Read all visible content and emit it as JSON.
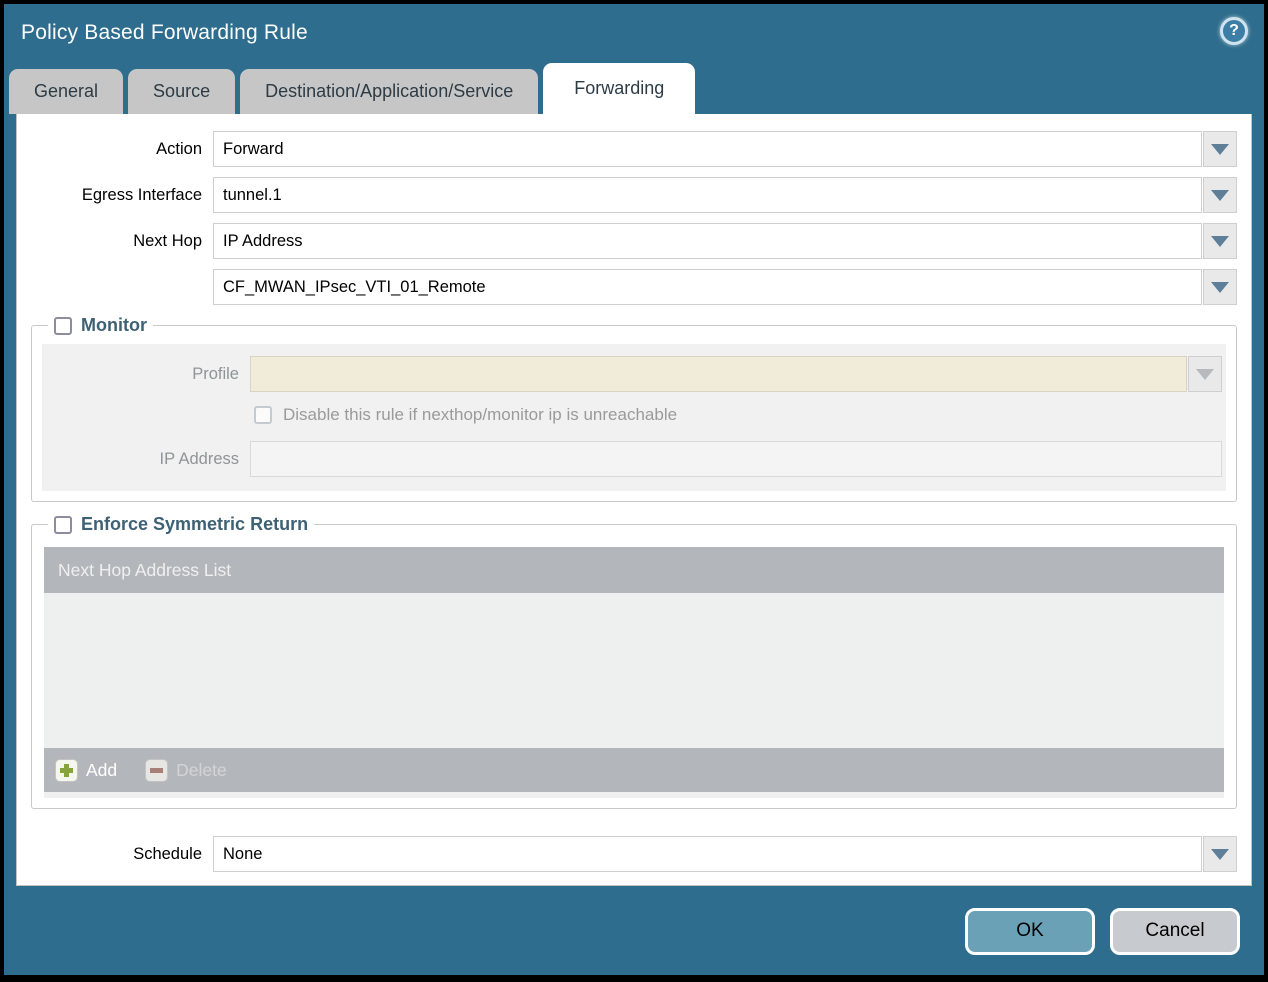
{
  "dialog": {
    "title": "Policy Based Forwarding Rule",
    "help_glyph": "?"
  },
  "tabs": [
    {
      "label": "General",
      "active": false
    },
    {
      "label": "Source",
      "active": false
    },
    {
      "label": "Destination/Application/Service",
      "active": false
    },
    {
      "label": "Forwarding",
      "active": true
    }
  ],
  "form": {
    "action": {
      "label": "Action",
      "value": "Forward"
    },
    "egress_interface": {
      "label": "Egress Interface",
      "value": "tunnel.1"
    },
    "next_hop": {
      "label": "Next Hop",
      "type_value": "IP Address",
      "address_value": "CF_MWAN_IPsec_VTI_01_Remote"
    },
    "schedule": {
      "label": "Schedule",
      "value": "None"
    }
  },
  "monitor": {
    "legend": "Monitor",
    "checked": false,
    "profile": {
      "label": "Profile",
      "value": ""
    },
    "disable_rule": {
      "label": "Disable this rule if nexthop/monitor ip is unreachable",
      "checked": false
    },
    "ip_address": {
      "label": "IP Address",
      "value": ""
    }
  },
  "symmetric_return": {
    "legend": "Enforce Symmetric Return",
    "checked": false,
    "table": {
      "header": "Next Hop Address List",
      "rows": []
    },
    "add_label": "Add",
    "delete_label": "Delete",
    "delete_enabled": false
  },
  "footer": {
    "ok_label": "OK",
    "cancel_label": "Cancel"
  },
  "colors": {
    "titlebar_teal": "#2e6d8d",
    "active_tab_bg": "#ffffff",
    "inactive_tab_bg": "#c6c6c6",
    "legend_text": "#3e6174",
    "table_gray": "#b3b7bc",
    "disabled_field_beige": "#f1ecd9",
    "ok_button": "#6ba1b7",
    "cancel_button": "#c7cbcf",
    "add_plus_green": "#86a33c",
    "delete_minus_red": "#a87f76"
  }
}
